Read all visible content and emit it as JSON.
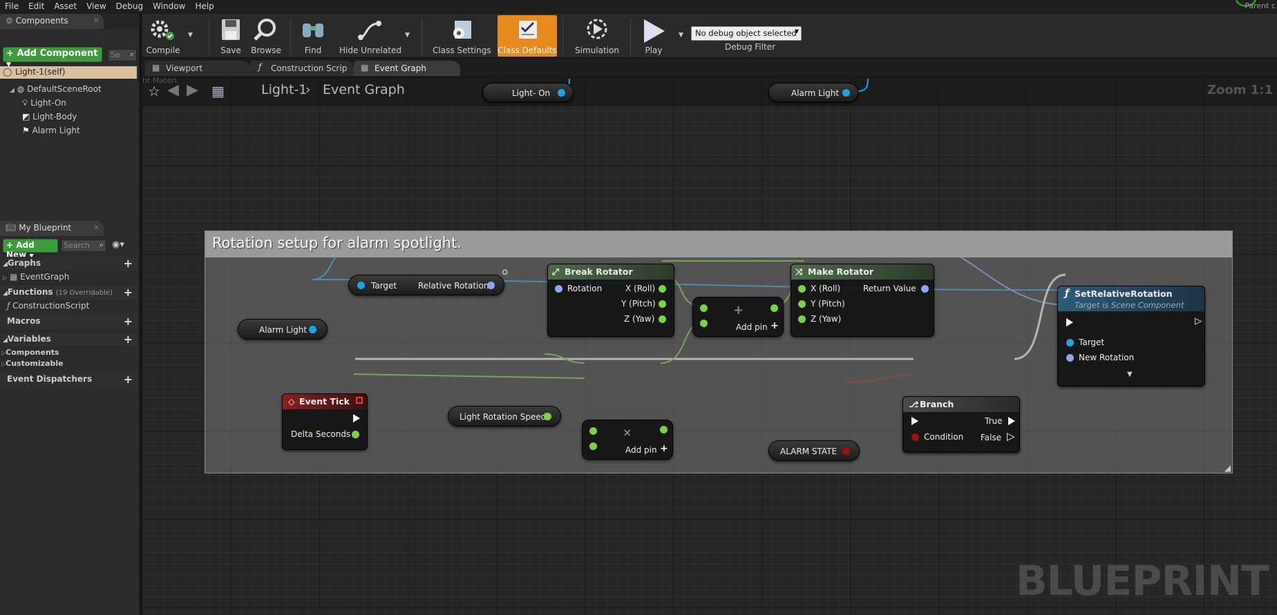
{
  "menu": [
    "File",
    "Edit",
    "Asset",
    "View",
    "Debug",
    "Window",
    "Help"
  ],
  "parent_text": "Parent c",
  "components_panel": {
    "tab": "Components",
    "add_button": "Add Component",
    "search_placeholder": "Se",
    "self_item": "Light-1(self)",
    "tree": [
      "DefaultSceneRoot",
      "Light-On",
      "Light-Body",
      "Alarm Light"
    ]
  },
  "my_blueprint": {
    "tab": "My Blueprint",
    "add_button": "Add New",
    "search_placeholder": "Search",
    "graphs_label": "Graphs",
    "event_graph": "EventGraph",
    "functions_label": "Functions",
    "functions_count": "(19 Overridable)",
    "construction_script": "ConstructionScript",
    "macros_label": "Macros",
    "variables_label": "Variables",
    "components_label": "Components",
    "customizable_label": "Customizable",
    "event_dispatchers_label": "Event Dispatchers"
  },
  "toolbar": {
    "compile": "Compile",
    "save": "Save",
    "browse": "Browse",
    "find": "Find",
    "hide_unrelated": "Hide Unrelated",
    "class_settings": "Class Settings",
    "class_defaults": "Class Defaults",
    "simulation": "Simulation",
    "play": "Play",
    "debug_object": "No debug object selected",
    "debug_filter": "Debug Filter"
  },
  "doc_tabs": [
    "Viewport",
    "Construction Scrip",
    "Event Graph"
  ],
  "breadcrumb": {
    "blueprint": "Light-1",
    "graph": "Event Graph",
    "zoom": "Zoom 1:1",
    "faded_text": "ht Materi"
  },
  "watermark": "BLUEPRINT",
  "comment_title": "Rotation setup for alarm spotlight.",
  "nodes": {
    "light_on_var": "Light- On",
    "alarm_light_top_var": "Alarm Light",
    "target_node": {
      "target": "Target",
      "relative_rotation": "Relative Rotation"
    },
    "alarm_light_var": "Alarm Light",
    "break_rotator": {
      "title": "Break Rotator",
      "rotation": "Rotation",
      "x": "X (Roll)",
      "y": "Y (Pitch)",
      "z": "Z (Yaw)"
    },
    "make_rotator": {
      "title": "Make Rotator",
      "x": "X (Roll)",
      "y": "Y (Pitch)",
      "z": "Z (Yaw)",
      "ret": "Return Value"
    },
    "set_relative_rotation": {
      "title": "SetRelativeRotation",
      "subtitle": "Target is Scene Component",
      "target": "Target",
      "new_rotation": "New Rotation"
    },
    "add_pin_1": "Add pin",
    "add_pin_2": "Add pin",
    "event_tick": {
      "title": "Event Tick",
      "delta": "Delta Seconds"
    },
    "light_rotation_speed": "Light Rotation Speed",
    "branch": {
      "title": "Branch",
      "condition": "Condition",
      "true": "True",
      "false": "False"
    },
    "alarm_state": "ALARM STATE"
  },
  "colors": {
    "green_pin": "#7ad53a",
    "blue_pin": "#1aa5e6",
    "struct_pin": "#8ea4f5",
    "bool_pin": "#a10e0e",
    "class_defaults_bg": "#e98a1e"
  }
}
